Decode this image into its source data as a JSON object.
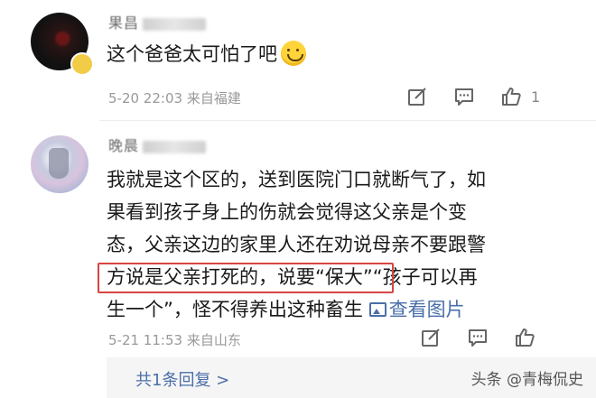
{
  "comments": [
    {
      "username": "果昌",
      "text": "这个爸爸太可怕了吧",
      "date": "5-20 22:03",
      "location": "来自福建",
      "likes": "1"
    },
    {
      "username": "晚晨",
      "lines": [
        "我就是这个区的，送到医院门口就断气了，如",
        "果看到孩子身上的伤就会觉得这父亲是个变",
        "态，父亲这边的家里人还在劝说母亲不要跟警",
        "方说是父亲打死的，说要“保大”“孩子可以再",
        "生一个”，怪不得养出这种畜生"
      ],
      "view_pictures": "查看图片",
      "date": "5-21 11:53",
      "location": "来自山东",
      "reply_link": "共1条回复 >"
    }
  ],
  "watermark": "头条 @青梅侃史",
  "colors": {
    "link": "#4a6ea9",
    "highlight": "#d64541",
    "meta": "#999999"
  }
}
